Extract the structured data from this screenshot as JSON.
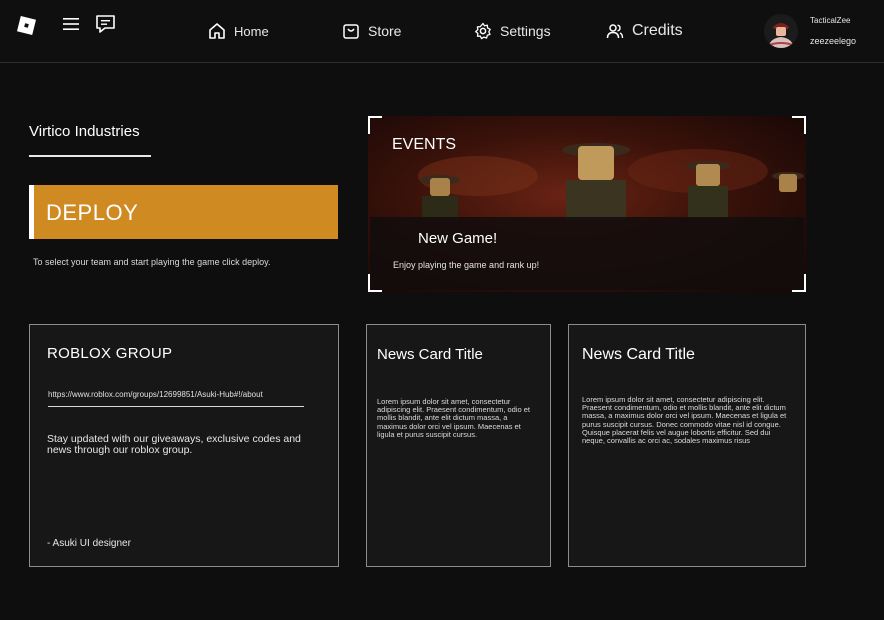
{
  "header": {
    "nav": {
      "home": "Home",
      "store": "Store",
      "settings": "Settings",
      "credits": "Credits"
    },
    "user": {
      "display_name": "TacticalZee",
      "username": "zeezeelego"
    }
  },
  "main": {
    "group_name": "Virtico Industries",
    "deploy": {
      "label": "DEPLOY",
      "help": "To select your team and start playing the game click deploy."
    },
    "events": {
      "title": "EVENTS",
      "card_title": "New Game!",
      "card_desc": "Enjoy playing the game and rank up!"
    },
    "roblox_group": {
      "title": "ROBLOX GROUP",
      "link": "https://www.roblox.com/groups/12699851/Asuki-Hub#!/about",
      "desc": "Stay updated with our giveaways, exclusive codes and news through our roblox group.",
      "signature": "- Asuki UI designer"
    },
    "news": [
      {
        "title": "News Card Title",
        "body": "Lorem ipsum dolor sit amet, consectetur adipiscing elit. Praesent condimentum, odio et mollis blandit, ante elit dictum massa, a maximus dolor orci vel ipsum. Maecenas et ligula et purus suscipit cursus."
      },
      {
        "title": "News Card Title",
        "body": "Lorem ipsum dolor sit amet, consectetur adipiscing elit. Praesent condimentum, odio et mollis blandit, ante elit dictum massa, a maximus dolor orci vel ipsum. Maecenas et ligula et purus suscipit cursus. Donec commodo vitae nisl id congue. Quisque placerat felis vel augue lobortis efficitur. Sed dui neque, convallis ac orci ac, sodales maximus risus"
      }
    ]
  },
  "colors": {
    "background": "#0e0e0e",
    "accent": "#cf8a22",
    "card": "#171717",
    "card_border": "#8c8c8c"
  },
  "icons": [
    "roblox-logo",
    "menu-icon",
    "chat-icon",
    "home-icon",
    "store-icon",
    "settings-icon",
    "credits-icon"
  ]
}
